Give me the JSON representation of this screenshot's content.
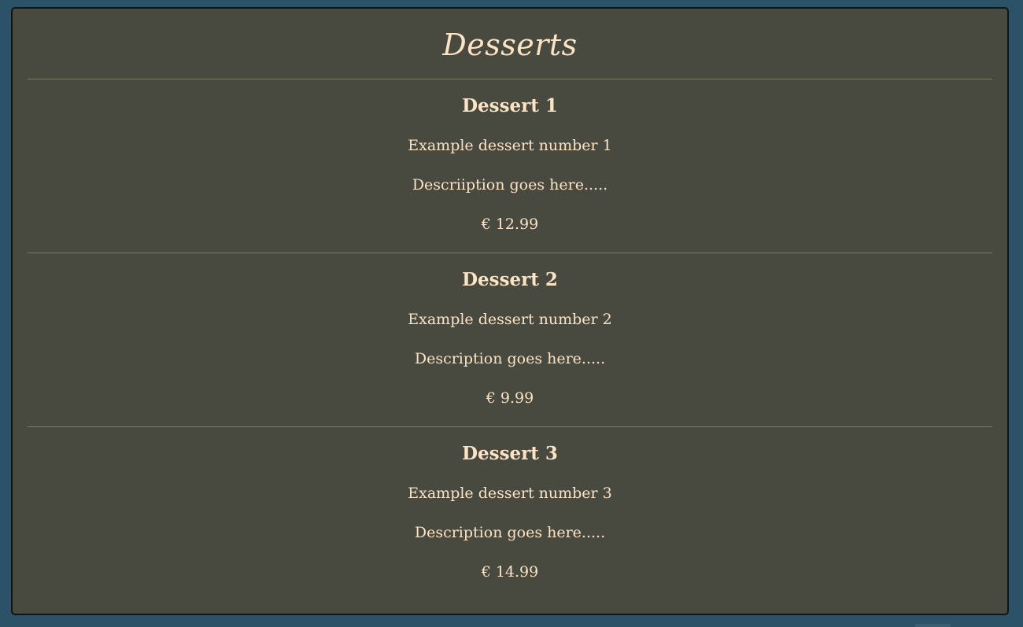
{
  "menu": {
    "section_title": "Desserts",
    "currency_symbol": "€",
    "items": [
      {
        "name": "Dessert 1",
        "subtitle": "Example dessert number 1",
        "description": "Descriiption goes here.....",
        "price": "12.99"
      },
      {
        "name": "Dessert 2",
        "subtitle": "Example dessert number 2",
        "description": "Description goes here.....",
        "price": "9.99"
      },
      {
        "name": "Dessert 3",
        "subtitle": "Example dessert number 3",
        "description": "Description goes here.....",
        "price": "14.99"
      }
    ]
  },
  "colors": {
    "page_background": "#2b5267",
    "panel_background": "#484a40",
    "text": "#fbe3c4",
    "divider": "#7b7f62"
  }
}
